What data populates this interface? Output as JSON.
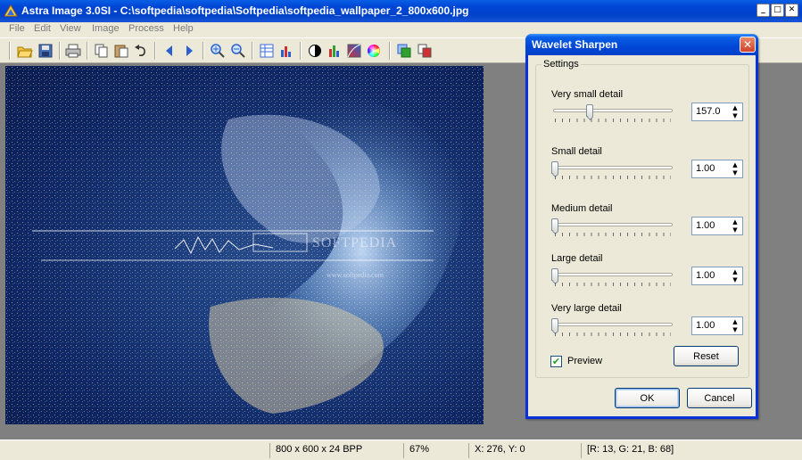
{
  "window": {
    "title": "Astra Image 3.0SI - C:\\softpedia\\softpedia\\Softpedia\\softpedia_wallpaper_2_800x600.jpg",
    "min": "_",
    "max": "□",
    "close": "✕"
  },
  "menu": [
    "File",
    "Edit",
    "View",
    "Image",
    "Process",
    "Help"
  ],
  "image": {
    "brand": "SOFTPEDIA",
    "url": "www.softpedia.com"
  },
  "status": {
    "dimensions": "800 x 600 x 24 BPP",
    "zoom": "67%",
    "coords": "X: 276, Y: 0",
    "rgb": "[R: 13, G: 21, B: 68]"
  },
  "dialog": {
    "title": "Wavelet Sharpen",
    "close": "✕",
    "group": "Settings",
    "params": [
      {
        "label": "Very small detail",
        "value": "157.0",
        "level": 0.3
      },
      {
        "label": "Small detail",
        "value": "1.00",
        "level": 0.0
      },
      {
        "label": "Medium detail",
        "value": "1.00",
        "level": 0.0
      },
      {
        "label": "Large detail",
        "value": "1.00",
        "level": 0.0
      },
      {
        "label": "Very large detail",
        "value": "1.00",
        "level": 0.0
      }
    ],
    "preview_label": "Preview",
    "preview_checked": true,
    "reset": "Reset",
    "ok": "OK",
    "cancel": "Cancel"
  }
}
